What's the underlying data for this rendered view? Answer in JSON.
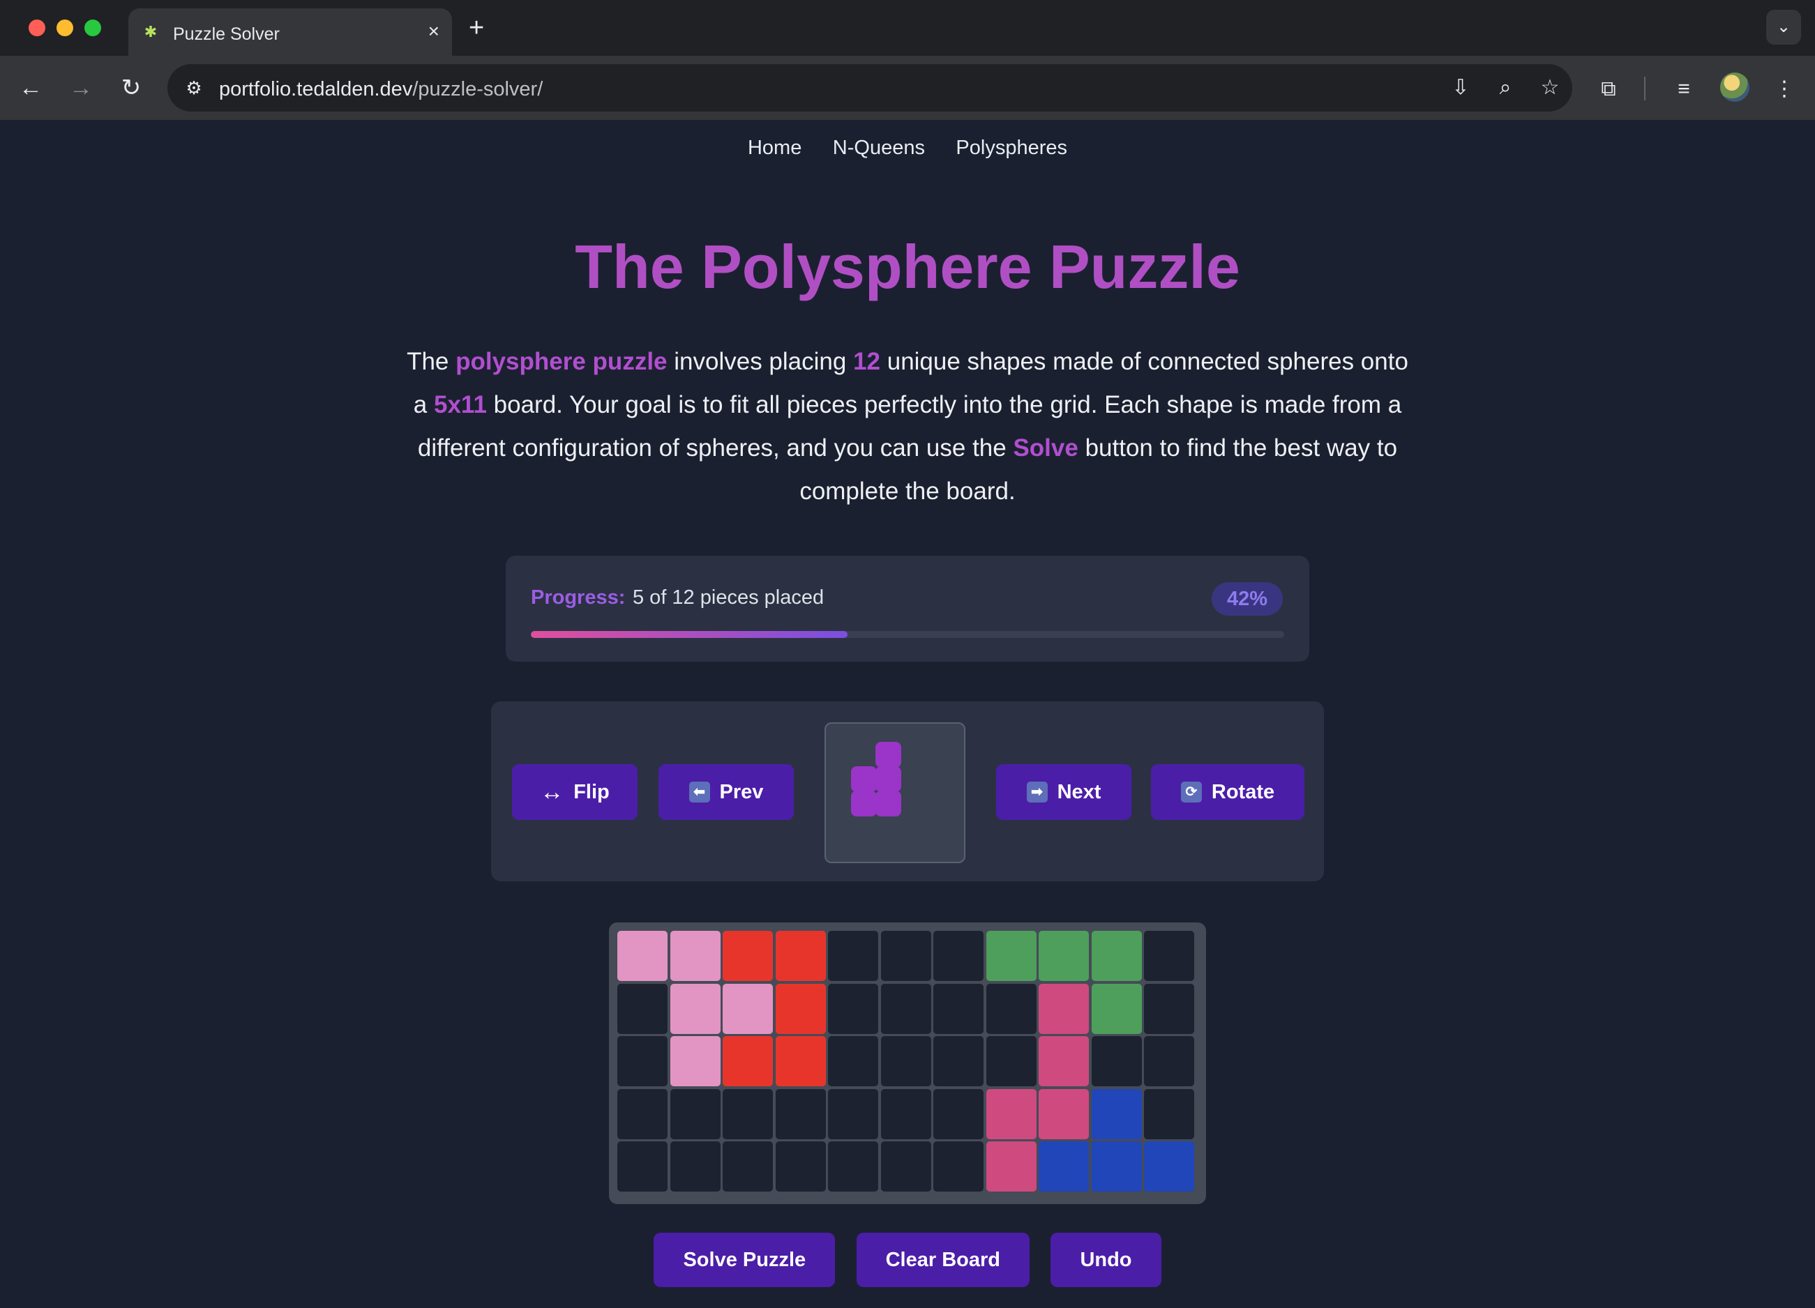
{
  "browser": {
    "tab_title": "Puzzle Solver",
    "url_domain": "portfolio.tedalden.dev",
    "url_path": "/puzzle-solver/",
    "new_tab_symbol": "+",
    "close_symbol": "×",
    "icons": [
      "back-icon",
      "forward-icon",
      "reload-icon",
      "site-info-icon",
      "install-app-icon",
      "zoom-icon",
      "bookmark-star-icon",
      "extensions-icon",
      "media-icon",
      "profile-avatar",
      "more-menu-icon"
    ]
  },
  "nav": {
    "links": [
      "Home",
      "N-Queens",
      "Polyspheres"
    ]
  },
  "hero": {
    "title": "The Polysphere Puzzle"
  },
  "intro": {
    "t1": "The ",
    "h1": "polysphere puzzle",
    "t2": " involves placing ",
    "h2": "12",
    "t3": " unique shapes made of connected spheres onto a ",
    "h3": "5x11",
    "t4": " board. Your goal is to fit all pieces perfectly into the grid. Each shape is made from a different configuration of spheres, and you can use the ",
    "h4": "Solve",
    "t5": " button to find the best way to complete the board."
  },
  "progress": {
    "label": "Progress:",
    "text": "5 of 12 pieces placed",
    "percent_label": "42%",
    "fraction": 0.42
  },
  "controls": {
    "flip": "Flip",
    "flip_icon": "↔",
    "prev": "Prev",
    "prev_icon": "⬅",
    "next": "Next",
    "next_icon": "➡",
    "rotate": "Rotate",
    "rotate_icon": "🔄",
    "preview_piece_color": "#9b34c9",
    "preview_piece_cells": [
      [
        0,
        1
      ],
      [
        1,
        0
      ],
      [
        1,
        1
      ],
      [
        2,
        0
      ],
      [
        2,
        1
      ]
    ]
  },
  "board": {
    "rows": 5,
    "cols": 11,
    "empty_color": "#1d2230",
    "colors": {
      "A": "#e295c2",
      "B": "#e8352c",
      "C": "#4e9f5b",
      "D": "#cf4a7f",
      "E": "#2146b9"
    },
    "grid": [
      "AABB...CCC.",
      ".AAB....DC.",
      ".ABB....D..",
      ".......DDE.",
      ".......DEEE"
    ]
  },
  "actions": {
    "solve": "Solve Puzzle",
    "clear": "Clear Board",
    "undo": "Undo"
  },
  "colors": {
    "page_bg": "#1b2030",
    "accent_purple": "#b04fc4",
    "button_bg": "#4b1ea8"
  }
}
